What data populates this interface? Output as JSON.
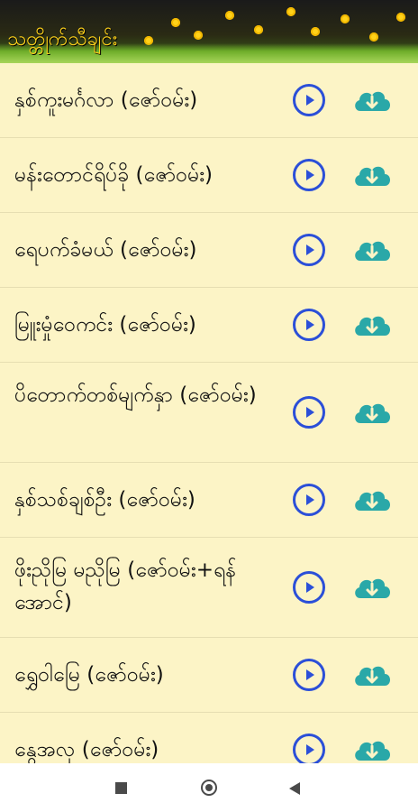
{
  "header": {
    "title": "သတ္တိုက်သီချင်း"
  },
  "list": {
    "items": [
      {
        "title": "နှစ်ကူးမင်္ဂလာ (ဇော်ဝမ်း)"
      },
      {
        "title": "မန်းတောင်ရိပ်ခို (ဇော်ဝမ်း)"
      },
      {
        "title": "ရေပက်ခံမယ် (ဇော်ဝမ်း)"
      },
      {
        "title": "မြူးမှုံဝေကင်း (ဇော်ဝမ်း)"
      },
      {
        "title": "ပိတောက်တစ်မျက်နှာ (ဇော်ဝမ်း)"
      },
      {
        "title": "နှစ်သစ်ချစ်ဦး (ဇော်ဝမ်း)"
      },
      {
        "title": "ဖိုးညိုမြ မညိုမြ (ဇော်ဝမ်း+ရန်အောင်)"
      },
      {
        "title": "ရွှေဝါမြေ (ဇော်ဝမ်း)"
      },
      {
        "title": "နွေအလှ (ဇော်ဝမ်း)"
      }
    ]
  },
  "icons": {
    "play": "play-circle-icon",
    "download": "cloud-download-icon"
  },
  "colors": {
    "background": "#fcf4c6",
    "play_accent": "#2b4fd8",
    "download_accent": "#2aa8a8"
  }
}
